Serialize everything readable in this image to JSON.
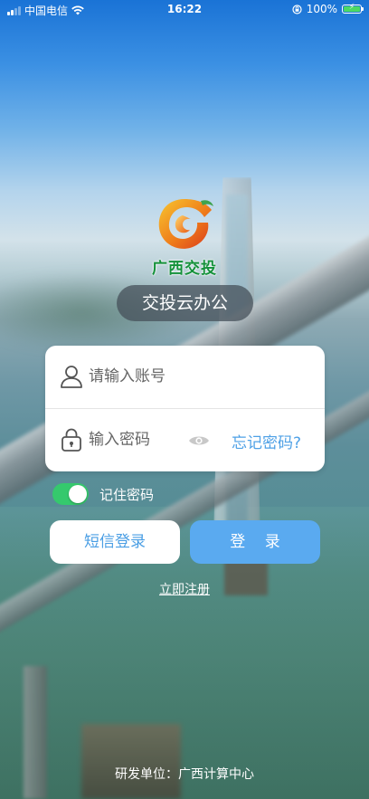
{
  "status_bar": {
    "carrier": "中国电信",
    "time": "16:22",
    "battery": "100%"
  },
  "brand": {
    "logo_text": "广西交投",
    "app_title": "交投云办公"
  },
  "login_form": {
    "account_placeholder": "请输入账号",
    "password_placeholder": "输入密码",
    "forgot_password": "忘记密码?",
    "remember_label": "记住密码",
    "remember_on": true
  },
  "actions": {
    "sms_login": "短信登录",
    "login": "登 录",
    "register": "立即注册"
  },
  "footer": {
    "developer": "研发单位：广西计算中心"
  },
  "icons": [
    "signal-icon",
    "wifi-icon",
    "rotation-lock-icon",
    "battery-icon",
    "user-icon",
    "lock-icon",
    "eye-icon"
  ],
  "colors": {
    "accent": "#5aaaf0",
    "link": "#4fa1e6",
    "toggle_on": "#35c96d",
    "brand_green": "#14913a"
  }
}
